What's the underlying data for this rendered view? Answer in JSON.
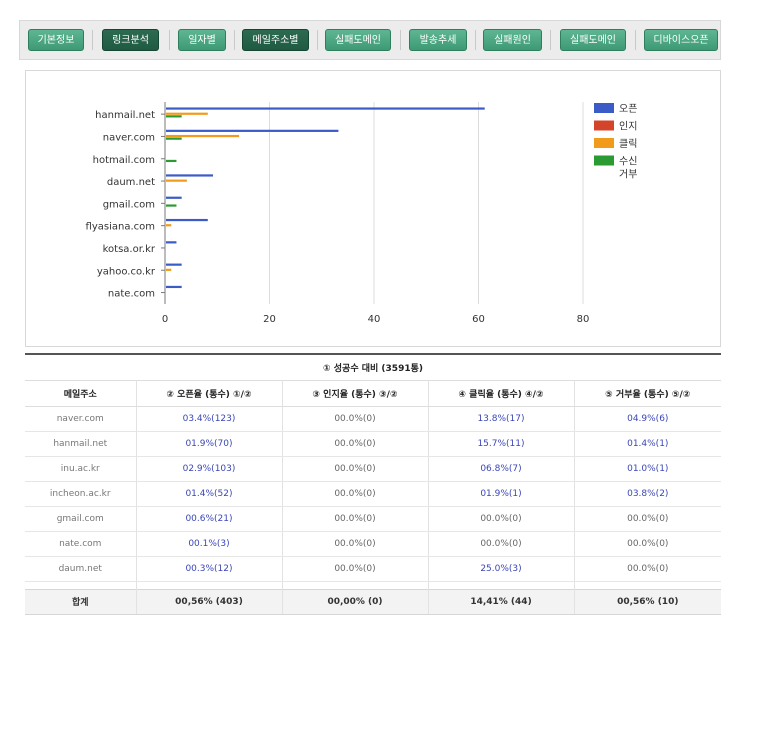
{
  "tabs": [
    {
      "label": "기본정보",
      "active": false
    },
    {
      "label": "링크분석",
      "active": true
    },
    {
      "label": "일자별",
      "active": false
    },
    {
      "label": "메일주소별",
      "active": true
    },
    {
      "label": "실패도메인",
      "active": false
    },
    {
      "label": "발송추세",
      "active": false
    },
    {
      "label": "실패원인",
      "active": false
    },
    {
      "label": "실패도메인",
      "active": false
    },
    {
      "label": "디바이스오픈",
      "active": false
    }
  ],
  "chart_data": {
    "type": "bar",
    "orientation": "horizontal",
    "categories": [
      "hanmail.net",
      "naver.com",
      "hotmail.com",
      "daum.net",
      "gmail.com",
      "flyasiana.com",
      "kotsa.or.kr",
      "yahoo.co.kr",
      "nate.com"
    ],
    "series": [
      {
        "name": "오픈",
        "color": "#3b5bc6",
        "values": [
          61,
          33,
          0,
          9,
          3,
          8,
          2,
          3,
          3
        ]
      },
      {
        "name": "인지",
        "color": "#d4442a",
        "values": [
          0,
          0,
          0,
          0,
          0,
          0,
          0,
          0,
          0
        ]
      },
      {
        "name": "클릭",
        "color": "#f29b1b",
        "values": [
          8,
          14,
          0,
          4,
          0,
          1,
          0,
          1,
          0
        ]
      },
      {
        "name": "수신\n거부",
        "color": "#2a9a32",
        "values": [
          3,
          3,
          2,
          0,
          2,
          0,
          0,
          0,
          0
        ]
      }
    ],
    "xlim": [
      0,
      80
    ],
    "xticks": [
      0,
      20,
      40,
      60,
      80
    ],
    "grid": true,
    "legend": "right"
  },
  "table": {
    "caption": "① 성공수 대비 (3591통)",
    "headers": [
      "메일주소",
      "② 오픈율 (통수) ①/②",
      "③ 인지율 (통수) ③/②",
      "④ 클릭율 (통수) ④/②",
      "⑤ 거부율 (통수) ⑤/②"
    ],
    "rows": [
      [
        "naver.com",
        "03.4%(123)",
        "00.0%(0)",
        "13.8%(17)",
        "04.9%(6)"
      ],
      [
        "hanmail.net",
        "01.9%(70)",
        "00.0%(0)",
        "15.7%(11)",
        "01.4%(1)"
      ],
      [
        "inu.ac.kr",
        "02.9%(103)",
        "00.0%(0)",
        "06.8%(7)",
        "01.0%(1)"
      ],
      [
        "incheon.ac.kr",
        "01.4%(52)",
        "00.0%(0)",
        "01.9%(1)",
        "03.8%(2)"
      ],
      [
        "gmail.com",
        "00.6%(21)",
        "00.0%(0)",
        "00.0%(0)",
        "00.0%(0)"
      ],
      [
        "nate.com",
        "00.1%(3)",
        "00.0%(0)",
        "00.0%(0)",
        "00.0%(0)"
      ],
      [
        "daum.net",
        "00.3%(12)",
        "00.0%(0)",
        "25.0%(3)",
        "00.0%(0)"
      ]
    ],
    "blue_cells": [
      [
        false,
        true,
        false,
        true,
        true
      ],
      [
        false,
        true,
        false,
        true,
        true
      ],
      [
        false,
        true,
        false,
        true,
        true
      ],
      [
        false,
        true,
        false,
        true,
        true
      ],
      [
        false,
        true,
        false,
        false,
        false
      ],
      [
        false,
        true,
        false,
        false,
        false
      ],
      [
        false,
        true,
        false,
        true,
        false
      ]
    ],
    "total": [
      "합계",
      "00,56% (403)",
      "00,00% (0)",
      "14,41% (44)",
      "00,56% (10)"
    ]
  }
}
